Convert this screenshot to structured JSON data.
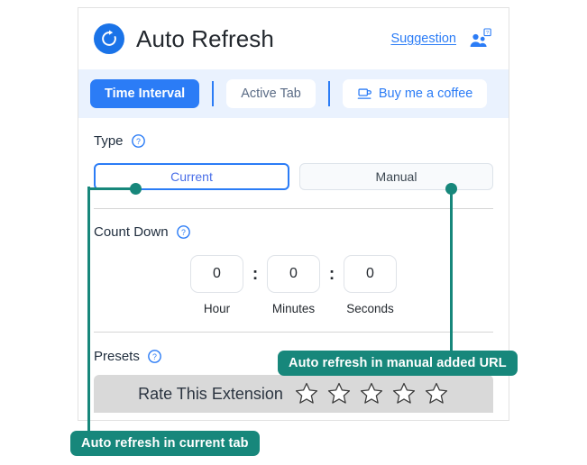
{
  "header": {
    "title": "Auto Refresh",
    "logo_icon": "refresh-circle-icon",
    "suggestion_label": "Suggestion",
    "people_icon": "people-question-icon"
  },
  "tabs": [
    {
      "label": "Time Interval",
      "state": "active"
    },
    {
      "label": "Active Tab",
      "state": "inactive"
    },
    {
      "label": "Buy me a coffee",
      "state": "inactive",
      "icon": "coffee-cup-icon"
    }
  ],
  "type_section": {
    "label": "Type",
    "help_icon": "question-circle-icon",
    "options": [
      {
        "label": "Current",
        "selected": true
      },
      {
        "label": "Manual",
        "selected": false
      }
    ]
  },
  "countdown_section": {
    "label": "Count Down",
    "help_icon": "question-circle-icon",
    "separator": ":",
    "fields": [
      {
        "value": "0",
        "caption": "Hour"
      },
      {
        "value": "0",
        "caption": "Minutes"
      },
      {
        "value": "0",
        "caption": "Seconds"
      }
    ]
  },
  "presets_section": {
    "label": "Presets",
    "help_icon": "question-circle-icon"
  },
  "rate_bar": {
    "text": "Rate This Extension",
    "star_icon": "star-outline-icon",
    "star_count": 5
  },
  "annotations": [
    {
      "id": "current-tab",
      "text": "Auto refresh in current tab"
    },
    {
      "id": "manual-url",
      "text": "Auto refresh in manual added URL"
    }
  ],
  "colors": {
    "brand_blue": "#2b7cf6",
    "logo_blue": "#1a73e8",
    "tabbar_bg": "#eaf2fe",
    "annotation_teal": "#17877b",
    "rate_bar_bg": "#d9d9d9"
  }
}
